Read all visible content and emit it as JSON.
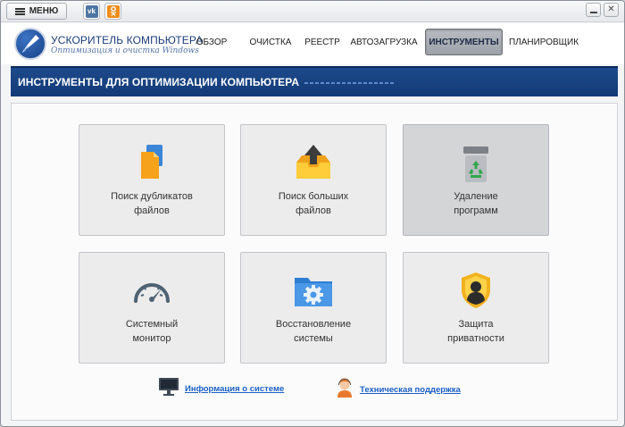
{
  "chrome": {
    "menu_label": "МЕНЮ",
    "social": [
      {
        "name": "vk",
        "glyph": "vk",
        "color": "#4d76a1"
      },
      {
        "name": "odnoklassniki",
        "glyph": "ok",
        "color": "#f08c1c"
      }
    ]
  },
  "header": {
    "logo_title": "УСКОРИТЕЛЬ КОМПЬЮТЕРА",
    "logo_subtitle": "Оптимизация и очистка Windows",
    "nav": [
      {
        "label": "ОБЗОР",
        "active": false
      },
      {
        "label": "ОЧИСТКА",
        "active": false
      },
      {
        "label": "РЕЕСТР",
        "active": false
      },
      {
        "label": "АВТОЗАГРУЗКА",
        "active": false
      },
      {
        "label": "ИНСТРУМЕНТЫ",
        "active": true
      },
      {
        "label": "ПЛАНИРОВЩИК",
        "active": false
      }
    ]
  },
  "banner": {
    "title": "ИНСТРУМЕНТЫ ДЛЯ ОПТИМИЗАЦИИ КОМПЬЮТЕРА"
  },
  "tiles": [
    {
      "label_line1": "Поиск дубликатов",
      "label_line2": "файлов",
      "icon": "duplicate-files-icon"
    },
    {
      "label_line1": "Поиск больших",
      "label_line2": "файлов",
      "icon": "large-files-icon"
    },
    {
      "label_line1": "Удаление",
      "label_line2": "программ",
      "icon": "recycle-bin-icon",
      "selected": true
    },
    {
      "label_line1": "Системный",
      "label_line2": "монитор",
      "icon": "speedometer-icon"
    },
    {
      "label_line1": "Восстановление",
      "label_line2": "системы",
      "icon": "gear-folder-icon"
    },
    {
      "label_line1": "Защита",
      "label_line2": "приватности",
      "icon": "privacy-shield-icon"
    }
  ],
  "links": {
    "system_info": "Информация о системе",
    "support": "Техническая поддержка"
  },
  "colors": {
    "accent": "#1b5fc4",
    "banner": "#1a4587",
    "active_tab": "#a9adb3"
  }
}
